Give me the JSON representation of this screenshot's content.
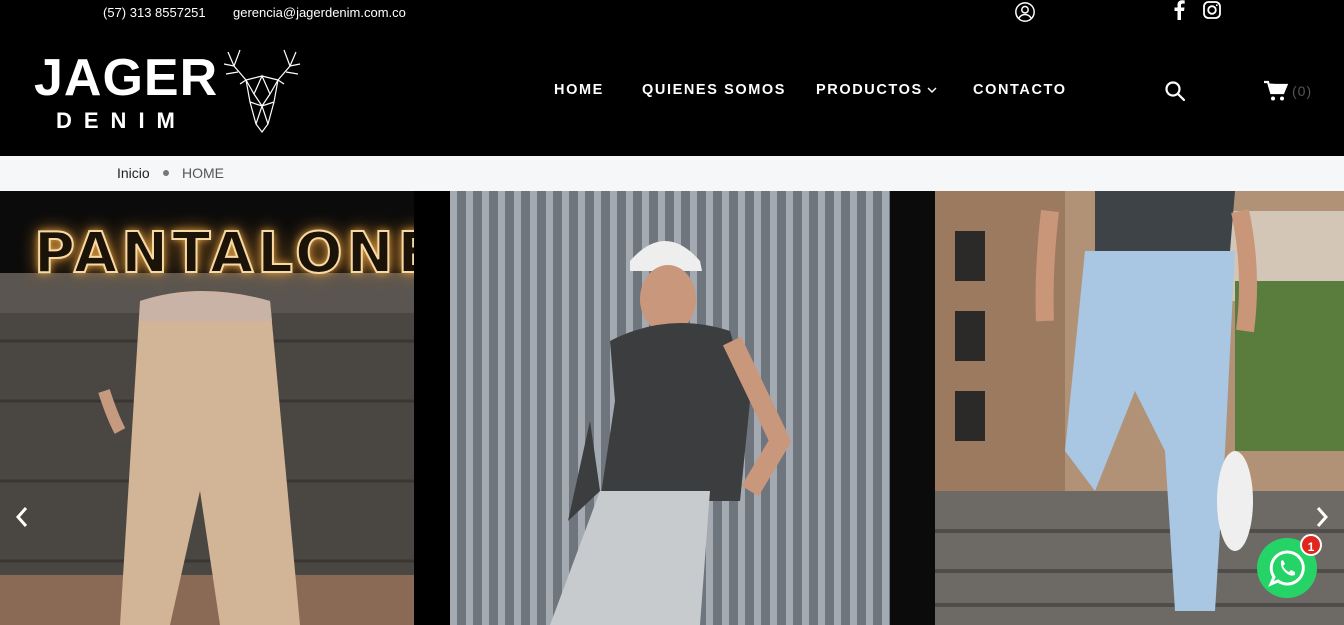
{
  "topbar": {
    "phone": "(57) 313 8557251",
    "email": "gerencia@jagerdenim.com.co",
    "icons": [
      "user-icon",
      "facebook-icon",
      "instagram-icon"
    ]
  },
  "header": {
    "logo": {
      "title": "JAGER",
      "subtitle": "DENIM"
    },
    "nav": {
      "home": "HOME",
      "quienes": "QUIENES SOMOS",
      "productos": "PRODUCTOS",
      "contacto": "CONTACTO"
    },
    "cart_count": "(0)"
  },
  "breadcrumb": {
    "inicio": "Inicio",
    "current": "HOME"
  },
  "hero": {
    "neon_text": "PANTALONES",
    "colors": {
      "neon": "#f7d9a4",
      "glow": "#e8a94a"
    }
  },
  "whatsapp": {
    "badge": "1",
    "color": "#25d366"
  }
}
